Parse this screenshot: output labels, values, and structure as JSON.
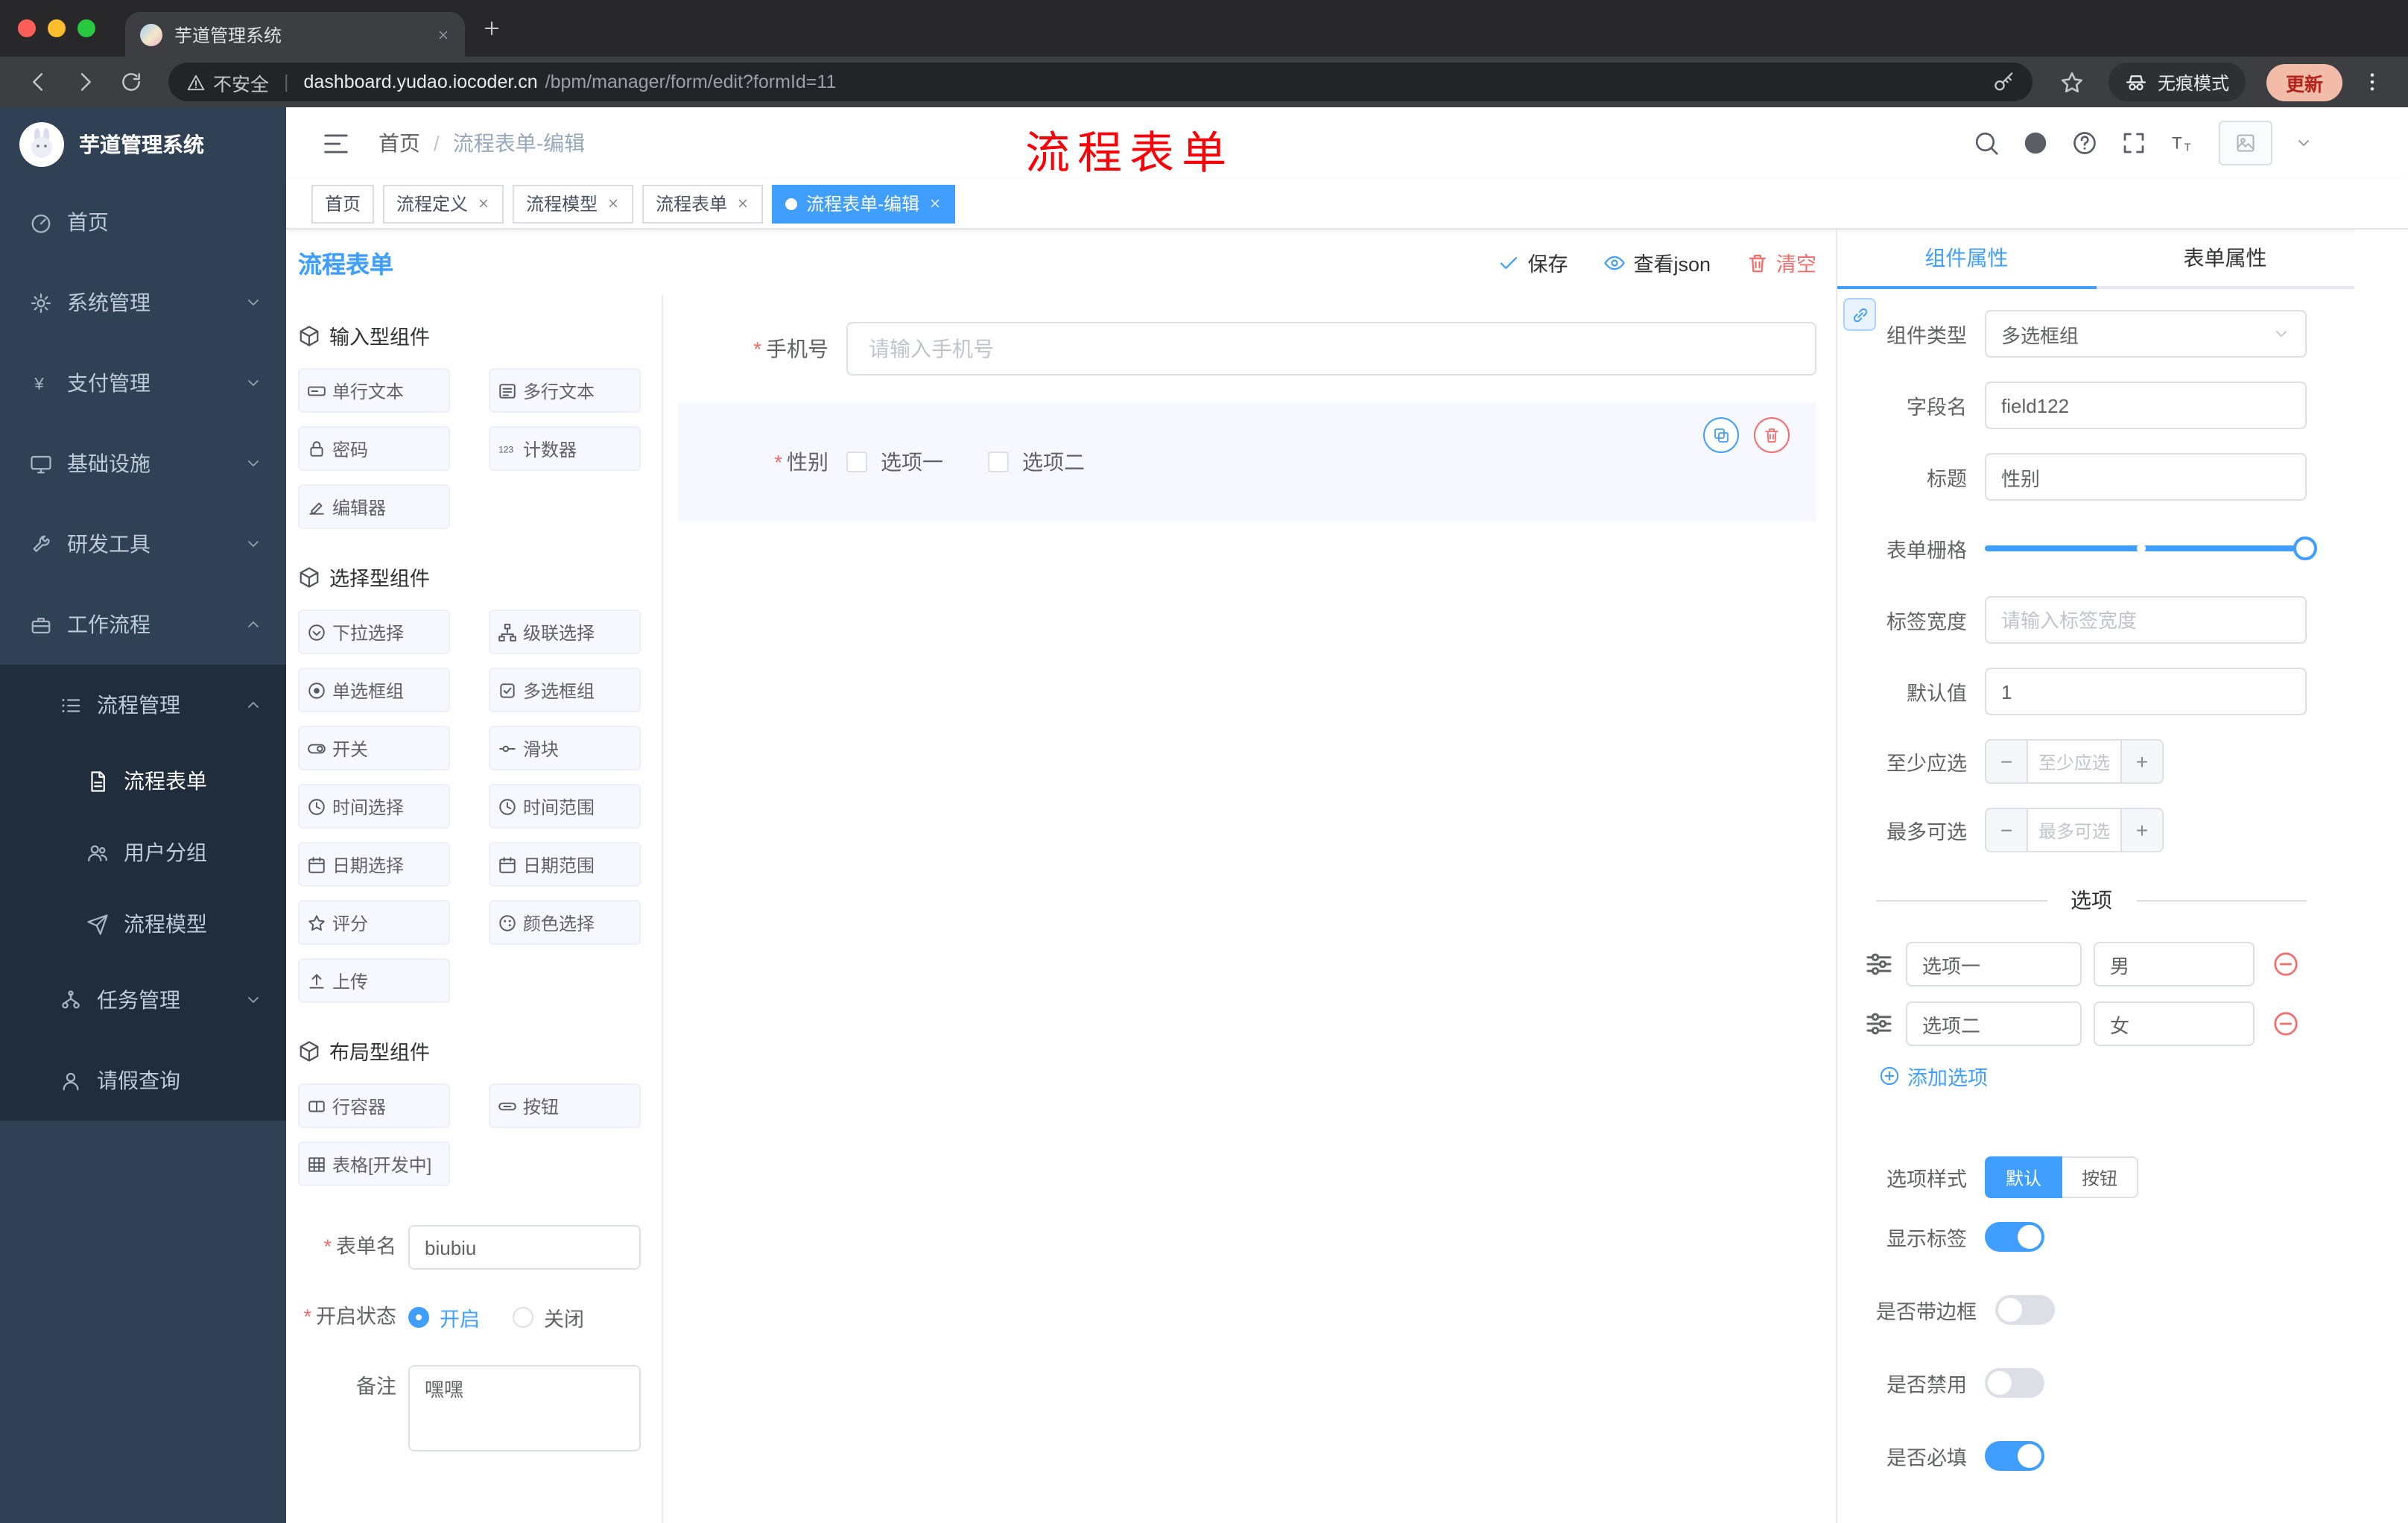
{
  "browser": {
    "tab_title": "芋道管理系统",
    "security_label": "不安全",
    "url_domain": "dashboard.yudao.iocoder.cn",
    "url_path": "/bpm/manager/form/edit?formId=11",
    "incognito_label": "无痕模式",
    "update_label": "更新"
  },
  "sidebar": {
    "logo_title": "芋道管理系统",
    "items": [
      {
        "label": "首页",
        "icon": "dashboard-icon"
      },
      {
        "label": "系统管理",
        "icon": "gear-icon"
      },
      {
        "label": "支付管理",
        "icon": "yen-icon"
      },
      {
        "label": "基础设施",
        "icon": "monitor-icon"
      },
      {
        "label": "研发工具",
        "icon": "wrench-icon"
      },
      {
        "label": "工作流程",
        "icon": "briefcase-icon"
      },
      {
        "label": "流程管理",
        "icon": "list-icon"
      },
      {
        "label": "流程表单",
        "icon": "document-icon"
      },
      {
        "label": "用户分组",
        "icon": "users-icon"
      },
      {
        "label": "流程模型",
        "icon": "send-icon"
      },
      {
        "label": "任务管理",
        "icon": "tree-icon"
      },
      {
        "label": "请假查询",
        "icon": "user-icon"
      }
    ]
  },
  "header": {
    "breadcrumb_home": "首页",
    "breadcrumb_current": "流程表单-编辑",
    "annotation": "流程表单"
  },
  "tags": [
    {
      "label": "首页",
      "closable": false,
      "active": false
    },
    {
      "label": "流程定义",
      "closable": true,
      "active": false
    },
    {
      "label": "流程模型",
      "closable": true,
      "active": false
    },
    {
      "label": "流程表单",
      "closable": true,
      "active": false
    },
    {
      "label": "流程表单-编辑",
      "closable": true,
      "active": true
    }
  ],
  "designer": {
    "title": "流程表单",
    "actions": {
      "save": "保存",
      "view_json": "查看json",
      "clear": "清空"
    },
    "palette": {
      "sections": [
        {
          "title": "输入型组件",
          "icon": "component-icon",
          "items": [
            {
              "label": "单行文本",
              "icon": "text-input-icon"
            },
            {
              "label": "多行文本",
              "icon": "textarea-icon"
            },
            {
              "label": "密码",
              "icon": "lock-icon"
            },
            {
              "label": "计数器",
              "icon": "counter-icon"
            },
            {
              "label": "编辑器",
              "icon": "editor-icon"
            }
          ]
        },
        {
          "title": "选择型组件",
          "icon": "component-icon",
          "items": [
            {
              "label": "下拉选择",
              "icon": "select-icon"
            },
            {
              "label": "级联选择",
              "icon": "cascader-icon"
            },
            {
              "label": "单选框组",
              "icon": "radio-icon"
            },
            {
              "label": "多选框组",
              "icon": "checkbox-icon"
            },
            {
              "label": "开关",
              "icon": "switch-icon"
            },
            {
              "label": "滑块",
              "icon": "slider-icon"
            },
            {
              "label": "时间选择",
              "icon": "time-icon"
            },
            {
              "label": "时间范围",
              "icon": "time-range-icon"
            },
            {
              "label": "日期选择",
              "icon": "date-icon"
            },
            {
              "label": "日期范围",
              "icon": "date-range-icon"
            },
            {
              "label": "评分",
              "icon": "rate-icon"
            },
            {
              "label": "颜色选择",
              "icon": "color-icon"
            },
            {
              "label": "上传",
              "icon": "upload-icon"
            }
          ]
        },
        {
          "title": "布局型组件",
          "icon": "component-icon",
          "items": [
            {
              "label": "行容器",
              "icon": "row-icon"
            },
            {
              "label": "按钮",
              "icon": "button-icon"
            },
            {
              "label": "表格[开发中]",
              "icon": "table-icon"
            }
          ]
        }
      ]
    },
    "meta": {
      "form_name": {
        "label": "表单名",
        "value": "biubiu",
        "required": true
      },
      "status": {
        "label": "开启状态",
        "on_label": "开启",
        "off_label": "关闭",
        "selected": "开启",
        "required": true
      },
      "remark": {
        "label": "备注",
        "value": "嘿嘿"
      }
    },
    "canvas": {
      "phone_field": {
        "label": "手机号",
        "placeholder": "请输入手机号",
        "required": true
      },
      "gender_field": {
        "label": "性别",
        "required": true,
        "options": [
          {
            "label": "选项一",
            "checked": false
          },
          {
            "label": "选项二",
            "checked": false
          }
        ]
      }
    }
  },
  "props": {
    "tabs": [
      {
        "label": "组件属性",
        "active": true
      },
      {
        "label": "表单属性",
        "active": false
      }
    ],
    "component_type": {
      "label": "组件类型",
      "value": "多选框组"
    },
    "field_name": {
      "label": "字段名",
      "value": "field122"
    },
    "title": {
      "label": "标题",
      "value": "性别"
    },
    "grid": {
      "label": "表单栅格"
    },
    "label_width": {
      "label": "标签宽度",
      "placeholder": "请输入标签宽度"
    },
    "default_value": {
      "label": "默认值",
      "value": "1"
    },
    "min_select": {
      "label": "至少应选",
      "placeholder": "至少应选"
    },
    "max_select": {
      "label": "最多可选",
      "placeholder": "最多可选"
    },
    "options_title": "选项",
    "options": [
      {
        "label": "选项一",
        "value": "男"
      },
      {
        "label": "选项二",
        "value": "女"
      }
    ],
    "add_option_label": "添加选项",
    "option_style": {
      "label": "选项样式",
      "choices": [
        "默认",
        "按钮"
      ],
      "active": "默认"
    },
    "switches": [
      {
        "label": "显示标签",
        "on": true
      },
      {
        "label": "是否带边框",
        "on": false
      },
      {
        "label": "是否禁用",
        "on": false
      },
      {
        "label": "是否必填",
        "on": true
      }
    ]
  },
  "colors": {
    "primary": "#409eff",
    "danger": "#f56c6c",
    "sidebar_bg": "#304156",
    "submenu_bg": "#1f2d3d",
    "annotation_red": "#fb0007"
  }
}
